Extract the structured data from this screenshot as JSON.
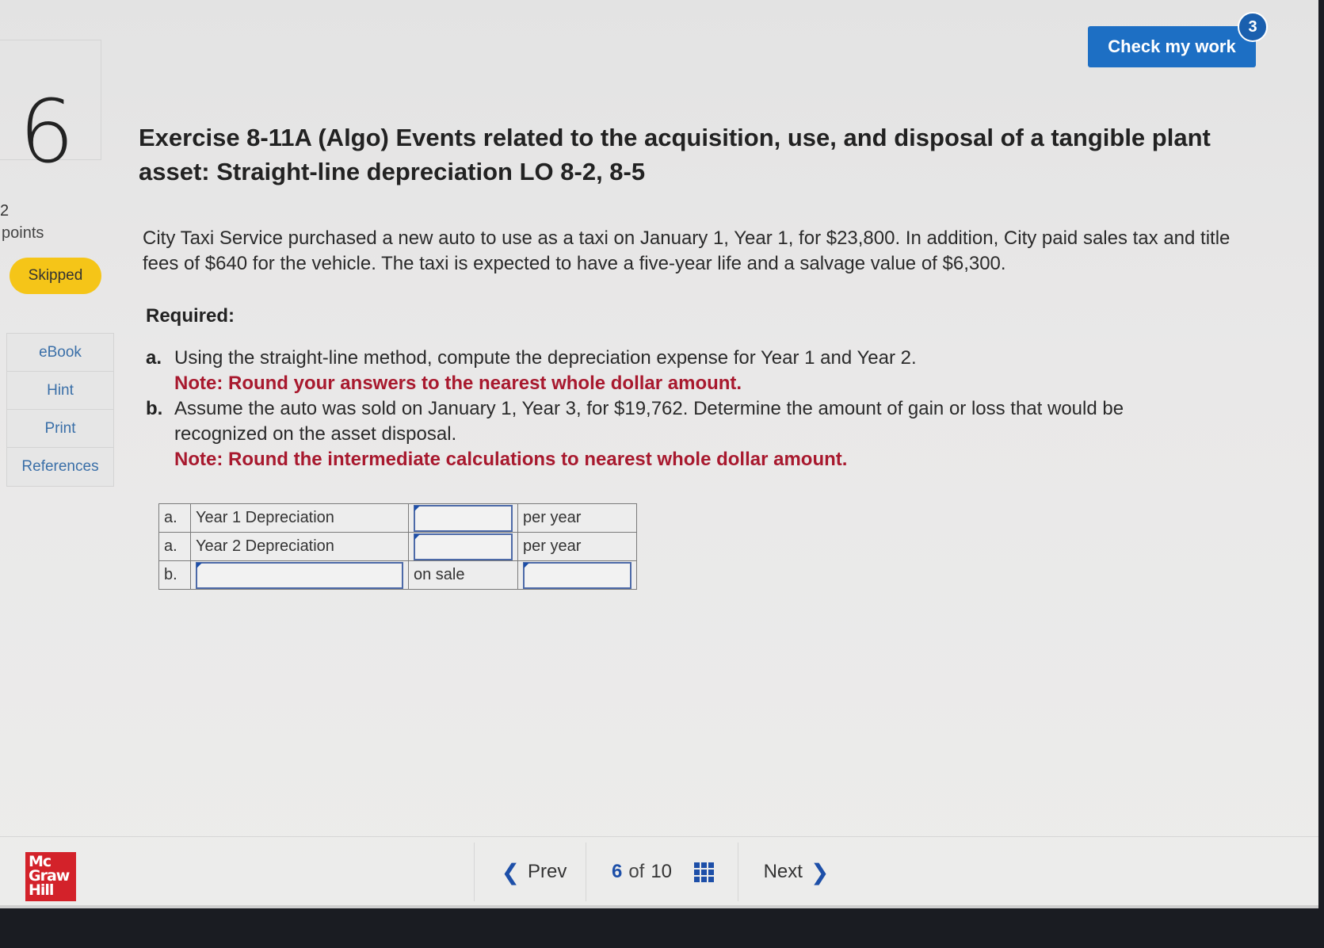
{
  "question": {
    "number": "6",
    "points_value": "2",
    "points_label": "points",
    "status": "Skipped"
  },
  "tools": [
    "eBook",
    "Hint",
    "Print",
    "References"
  ],
  "header": {
    "check_label": "Check my work",
    "check_badge": "3"
  },
  "exercise": {
    "title": "Exercise 8-11A (Algo) Events related to the acquisition, use, and disposal of a tangible plant asset: Straight-line depreciation LO 8-2, 8-5",
    "intro": "City Taxi Service purchased a new auto to use as a taxi on January 1, Year 1, for $23,800. In addition, City paid sales tax and title fees of $640 for the vehicle. The taxi is expected to have a five-year life and a salvage value of $6,300.",
    "required_label": "Required:",
    "items": [
      {
        "letter": "a.",
        "text": "Using the straight-line method, compute the depreciation expense for Year 1 and Year 2.",
        "note": "Note: Round your answers to the nearest whole dollar amount."
      },
      {
        "letter": "b.",
        "text": "Assume the auto was sold on January 1, Year 3, for $19,762. Determine the amount of gain or loss that would be recognized on the asset disposal.",
        "note": "Note: Round the intermediate calculations to nearest whole dollar amount."
      }
    ]
  },
  "answer_table": {
    "rows": [
      {
        "letter": "a.",
        "label": "Year 1 Depreciation",
        "value": "",
        "unit": "per year"
      },
      {
        "letter": "a.",
        "label": "Year 2 Depreciation",
        "value": "",
        "unit": "per year"
      },
      {
        "letter": "b.",
        "label": "",
        "mid": "on sale",
        "value": ""
      }
    ]
  },
  "footer": {
    "logo_lines": [
      "Mc",
      "Graw",
      "Hill"
    ],
    "prev_label": "Prev",
    "page_current": "6",
    "page_of": "of",
    "page_total": "10",
    "next_label": "Next"
  }
}
